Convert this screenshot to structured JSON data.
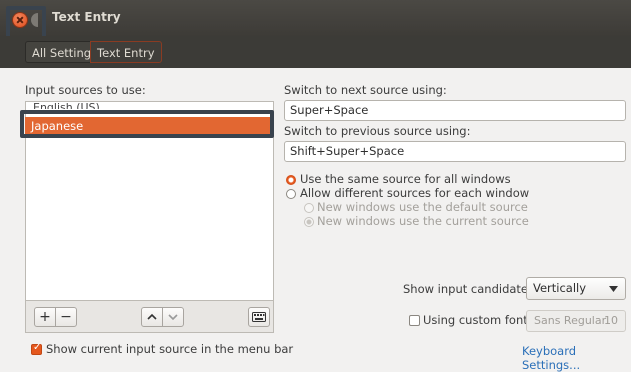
{
  "window": {
    "title": "Text Entry"
  },
  "header": {
    "breadcrumbs": [
      "All Settings",
      "Text Entry"
    ]
  },
  "sources": {
    "heading": "Input sources to use:",
    "items": [
      "English (US)",
      "Japanese"
    ],
    "selected": "Japanese"
  },
  "toolbar": {
    "add_label": "+",
    "remove_label": "−",
    "up_label": "⌃",
    "down_label": "⌄"
  },
  "switching": {
    "next_label": "Switch to next source using:",
    "next_value": "Super+Space",
    "prev_label": "Switch to previous source using:",
    "prev_value": "Shift+Super+Space"
  },
  "per_window": {
    "option_same": "Use the same source for all windows",
    "option_different": "Allow different sources for each window",
    "sub_default": "New windows use the default source",
    "sub_current": "New windows use the current source"
  },
  "candidates": {
    "label": "Show input candidates:",
    "value": "Vertically"
  },
  "font": {
    "label": "Using custom font:",
    "value": "Sans Regular",
    "size": "10"
  },
  "menubar": {
    "label": "Show current input source in the menu bar",
    "checked": true
  },
  "link": {
    "keyboard_settings": "Keyboard Settings..."
  },
  "colors": {
    "accent": "#e26732",
    "titlebar": "#3c3b37",
    "link": "#2a6fb8"
  }
}
